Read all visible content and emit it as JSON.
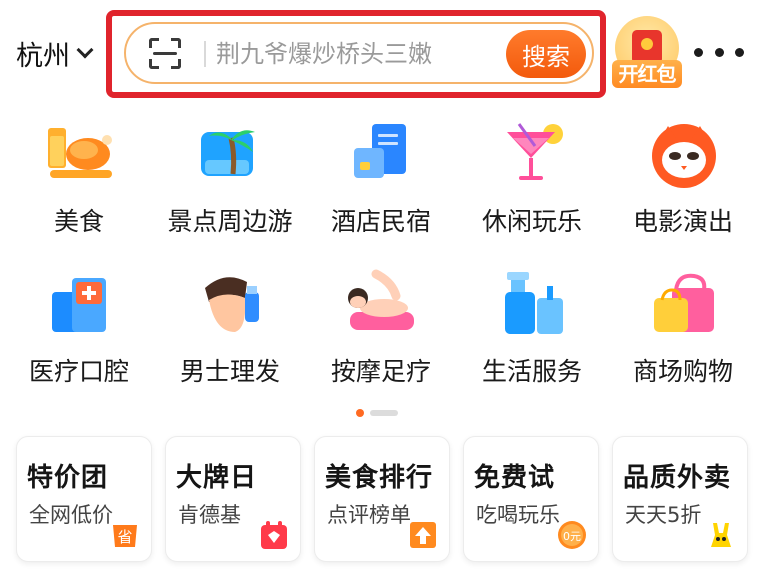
{
  "header": {
    "city": "杭州",
    "search_placeholder": "荆九爷爆炒桥头三嫩",
    "search_button": "搜索",
    "red_packet_label": "开红包"
  },
  "categories_row1": [
    {
      "label": "美食",
      "icon": "food-icon"
    },
    {
      "label": "景点周边游",
      "icon": "palm-tree-icon"
    },
    {
      "label": "酒店民宿",
      "icon": "hotel-icon"
    },
    {
      "label": "休闲玩乐",
      "icon": "cocktail-icon"
    },
    {
      "label": "电影演出",
      "icon": "cat-mask-icon"
    }
  ],
  "categories_row2": [
    {
      "label": "医疗口腔",
      "icon": "medical-icon"
    },
    {
      "label": "男士理发",
      "icon": "haircut-icon"
    },
    {
      "label": "按摩足疗",
      "icon": "massage-icon"
    },
    {
      "label": "生活服务",
      "icon": "cleaning-icon"
    },
    {
      "label": "商场购物",
      "icon": "shopping-bag-icon"
    }
  ],
  "pager": {
    "active_index": 0,
    "count": 2
  },
  "promo_cards": [
    {
      "title": "特价团",
      "subtitle": "全网低价",
      "badge_text": "省",
      "badge_icon": "save-badge-icon"
    },
    {
      "title": "大牌日",
      "subtitle": "肯德基",
      "badge_text": "",
      "badge_icon": "calendar-badge-icon"
    },
    {
      "title": "美食排行",
      "subtitle": "点评榜单",
      "badge_text": "",
      "badge_icon": "up-arrow-badge-icon"
    },
    {
      "title": "免费试",
      "subtitle": "吃喝玩乐",
      "badge_text": "0元",
      "badge_icon": "zero-yuan-badge-icon"
    },
    {
      "title": "品质外卖",
      "subtitle": "天天5折",
      "badge_text": "",
      "badge_icon": "mascot-icon"
    }
  ],
  "colors": {
    "accent": "#f35a0c",
    "search_border": "#f5b36b",
    "highlight_box": "#e0242c"
  }
}
